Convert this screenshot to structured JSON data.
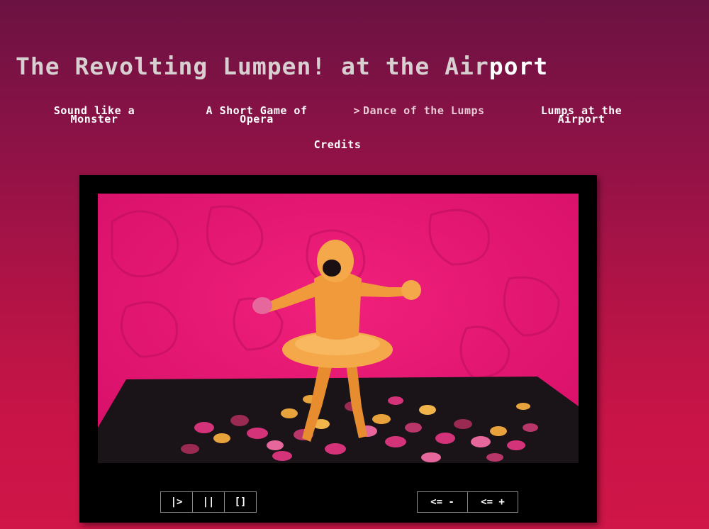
{
  "title": {
    "main": "The Revolting Lumpen! at the Air",
    "highlight": "port"
  },
  "nav": {
    "items": [
      {
        "label": "Sound like a Monster"
      },
      {
        "label": "A Short Game of Opera"
      },
      {
        "arrow": ">",
        "label": "Dance of the Lumps"
      },
      {
        "label": "Lumps at the Airport"
      },
      {
        "label": "Credits"
      }
    ]
  },
  "player": {
    "buttons": {
      "play": "|>",
      "pause": "||",
      "fullscreen": "[]",
      "speed_down": "<= -",
      "speed_up": "<= +"
    }
  },
  "colors": {
    "bg_top": "#6b1242",
    "bg_bottom": "#d01548",
    "video_bg": "#e3166f",
    "figure": "#f19a3c",
    "title": "#d8cfd0"
  }
}
